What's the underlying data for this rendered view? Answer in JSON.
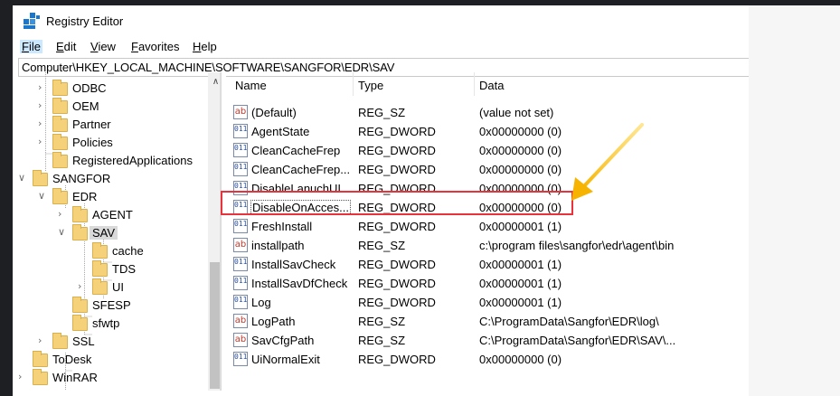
{
  "window": {
    "title": "Registry Editor"
  },
  "menu": [
    {
      "accel": "F",
      "rest": "ile"
    },
    {
      "accel": "E",
      "rest": "dit"
    },
    {
      "accel": "V",
      "rest": "iew"
    },
    {
      "accel": "F",
      "rest": "avorites"
    },
    {
      "accel": "H",
      "rest": "elp"
    }
  ],
  "address": "Computer\\HKEY_LOCAL_MACHINE\\SOFTWARE\\SANGFOR\\EDR\\SAV",
  "tree": [
    {
      "label": "ODBC",
      "expander": "collapsed"
    },
    {
      "label": "OEM",
      "expander": "collapsed"
    },
    {
      "label": "Partner",
      "expander": "collapsed"
    },
    {
      "label": "Policies",
      "expander": "collapsed"
    },
    {
      "label": "RegisteredApplications",
      "expander": "none"
    },
    {
      "label": "SANGFOR",
      "expander": "expanded"
    },
    {
      "label": "EDR",
      "expander": "expanded"
    },
    {
      "label": "AGENT",
      "expander": "collapsed"
    },
    {
      "label": "SAV",
      "expander": "expanded",
      "selected": true
    },
    {
      "label": "cache",
      "expander": "none"
    },
    {
      "label": "TDS",
      "expander": "none"
    },
    {
      "label": "UI",
      "expander": "collapsed"
    },
    {
      "label": "SFESP",
      "expander": "none"
    },
    {
      "label": "sfwtp",
      "expander": "none"
    },
    {
      "label": "SSL",
      "expander": "collapsed"
    },
    {
      "label": "ToDesk",
      "expander": "none"
    },
    {
      "label": "WinRAR",
      "expander": "collapsed"
    }
  ],
  "columns": {
    "name": "Name",
    "type": "Type",
    "data": "Data"
  },
  "values": [
    {
      "icon": "string-value-icon",
      "icon_text": "ab",
      "name": "(Default)",
      "type": "REG_SZ",
      "data": "(value not set)"
    },
    {
      "icon": "dword-value-icon",
      "icon_text": "0110",
      "name": "AgentState",
      "type": "REG_DWORD",
      "data": "0x00000000 (0)"
    },
    {
      "icon": "dword-value-icon",
      "icon_text": "0110",
      "name": "CleanCacheFrep",
      "type": "REG_DWORD",
      "data": "0x00000000 (0)"
    },
    {
      "icon": "dword-value-icon",
      "icon_text": "0110",
      "name": "CleanCacheFrep...",
      "type": "REG_DWORD",
      "data": "0x00000000 (0)"
    },
    {
      "icon": "dword-value-icon",
      "icon_text": "0110",
      "name": "DisableLanuchUI",
      "type": "REG_DWORD",
      "data": "0x00000000 (0)"
    },
    {
      "icon": "dword-value-icon",
      "icon_text": "0110",
      "name": "DisableOnAcces...",
      "type": "REG_DWORD",
      "data": "0x00000000 (0)",
      "focused": true
    },
    {
      "icon": "dword-value-icon",
      "icon_text": "0110",
      "name": "FreshInstall",
      "type": "REG_DWORD",
      "data": "0x00000001 (1)"
    },
    {
      "icon": "string-value-icon",
      "icon_text": "ab",
      "name": "installpath",
      "type": "REG_SZ",
      "data": "c:\\program files\\sangfor\\edr\\agent\\bin"
    },
    {
      "icon": "dword-value-icon",
      "icon_text": "0110",
      "name": "InstallSavCheck",
      "type": "REG_DWORD",
      "data": "0x00000001 (1)"
    },
    {
      "icon": "dword-value-icon",
      "icon_text": "0110",
      "name": "InstallSavDfCheck",
      "type": "REG_DWORD",
      "data": "0x00000001 (1)"
    },
    {
      "icon": "dword-value-icon",
      "icon_text": "0110",
      "name": "Log",
      "type": "REG_DWORD",
      "data": "0x00000001 (1)"
    },
    {
      "icon": "string-value-icon",
      "icon_text": "ab",
      "name": "LogPath",
      "type": "REG_SZ",
      "data": "C:\\ProgramData\\Sangfor\\EDR\\log\\"
    },
    {
      "icon": "string-value-icon",
      "icon_text": "ab",
      "name": "SavCfgPath",
      "type": "REG_SZ",
      "data": "C:\\ProgramData\\Sangfor\\EDR\\SAV\\..."
    },
    {
      "icon": "dword-value-icon",
      "icon_text": "0110",
      "name": "UiNormalExit",
      "type": "REG_DWORD",
      "data": "0x00000000 (0)"
    }
  ],
  "colors": {
    "highlight": "#e8323c",
    "arrow": "#f6b400",
    "folder": "#f5d27a",
    "selection": "#d9d9d9"
  }
}
